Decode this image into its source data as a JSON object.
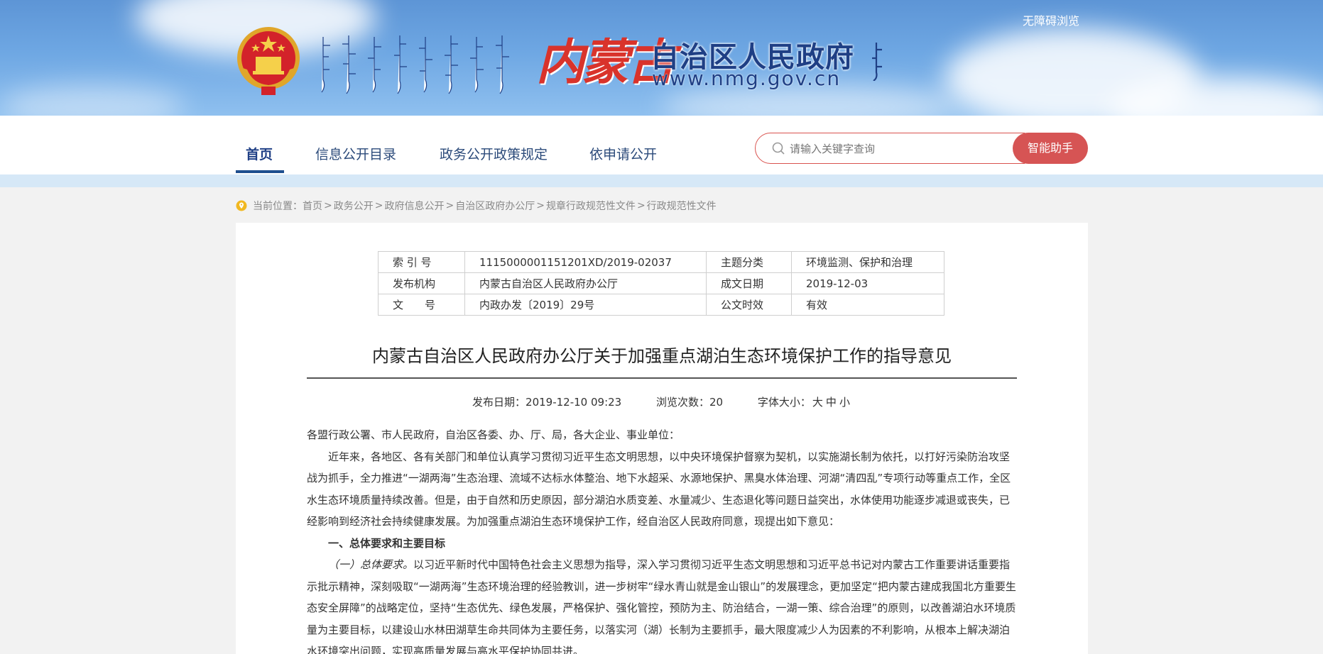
{
  "header": {
    "accessibility_label": "无障碍浏览",
    "logo_red_text": "内蒙古",
    "logo_title": "自治区人民政府",
    "logo_url": "www.nmg.gov.cn"
  },
  "nav": {
    "items": [
      "首页",
      "信息公开目录",
      "政务公开政策规定",
      "依申请公开"
    ],
    "active_index": 0
  },
  "search": {
    "placeholder": "请输入关键字查询",
    "assistant_label": "智能助手"
  },
  "breadcrumb": {
    "prefix": "当前位置：",
    "items": [
      "首页",
      "政务公开",
      "政府信息公开",
      "自治区政府办公厅",
      "规章行政规范性文件",
      "行政规范性文件"
    ],
    "separator": ">"
  },
  "meta": {
    "index_label": "索 引 号",
    "index_value": "1115000001151201XD/2019-02037",
    "topic_label": "主题分类",
    "topic_value": "环境监测、保护和治理",
    "issuer_label": "发布机构",
    "issuer_value": "内蒙古自治区人民政府办公厅",
    "date_label": "成文日期",
    "date_value": "2019-12-03",
    "docno_label": "文　　号",
    "docno_value": "内政办发〔2019〕29号",
    "validity_label": "公文时效",
    "validity_value": "有效"
  },
  "article": {
    "title": "内蒙古自治区人民政府办公厅关于加强重点湖泊生态环境保护工作的指导意见",
    "publish_label": "发布日期：",
    "publish_date": "2019-12-10 09:23",
    "views_label": "浏览次数：",
    "views_count": "20",
    "font_size_label": "字体大小：",
    "font_size_options": [
      "大",
      "中",
      "小"
    ],
    "salutation": "各盟行政公署、市人民政府，自治区各委、办、厅、局，各大企业、事业单位：",
    "para1": "近年来，各地区、各有关部门和单位认真学习贯彻习近平生态文明思想，以中央环境保护督察为契机，以实施湖长制为依托，以打好污染防治攻坚战为抓手，全力推进“一湖两海”生态治理、流域不达标水体整治、地下水超采、水源地保护、黑臭水体治理、河湖“清四乱”专项行动等重点工作，全区水生态环境质量持续改善。但是，由于自然和历史原因，部分湖泊水质变差、水量减少、生态退化等问题日益突出，水体使用功能逐步减退或丧失，已经影响到经济社会持续健康发展。为加强重点湖泊生态环境保护工作，经自治区人民政府同意，现提出如下意见：",
    "section1_heading": "一、总体要求和主要目标",
    "sub1_label": "（一）总体要求。",
    "sub1_text": "以习近平新时代中国特色社会主义思想为指导，深入学习贯彻习近平生态文明思想和习近平总书记对内蒙古工作重要讲话重要指示批示精神，深刻吸取“一湖两海”生态环境治理的经验教训，进一步树牢“绿水青山就是金山银山”的发展理念，更加坚定“把内蒙古建成我国北方重要生态安全屏障”的战略定位，坚持“生态优先、绿色发展，严格保护、强化管控，预防为主、防治结合，一湖一策、综合治理”的原则，以改善湖泊水环境质量为主要目标，以建设山水林田湖草生命共同体为主要任务，以落实河（湖）长制为主要抓手，最大限度减少人为因素的不利影响，从根本上解决湖泊水环境突出问题，实现高质量发展与高水平保护协同共进。"
  },
  "colors": {
    "brand_blue": "#1f3f85",
    "accent_red": "#d65454",
    "logo_red": "#d9332b"
  }
}
